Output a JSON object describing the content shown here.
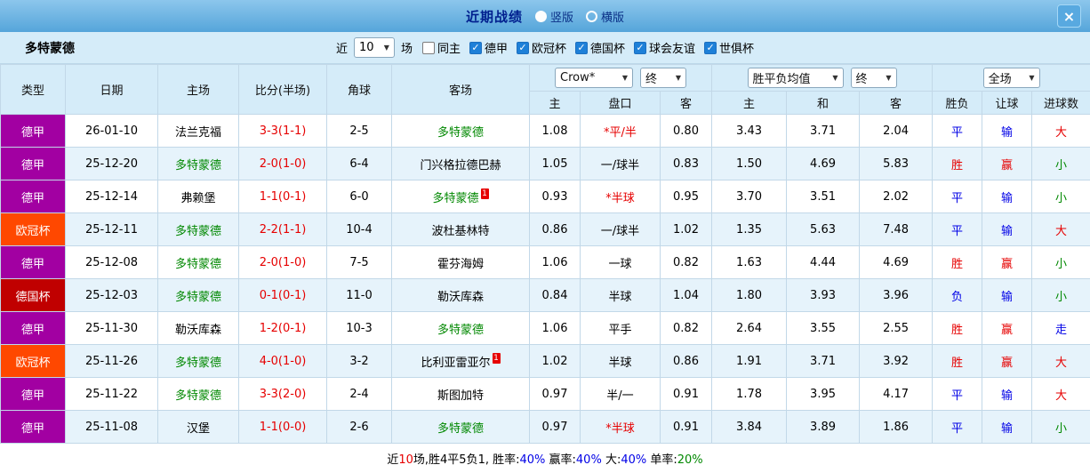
{
  "titlebar": {
    "title": "近期战绩",
    "close_glyph": "×",
    "radios": [
      {
        "label": "竖版",
        "selected": true
      },
      {
        "label": "横版",
        "selected": false
      }
    ]
  },
  "filterbar": {
    "team": "多特蒙德",
    "recent_label": "近",
    "recent_value": "10",
    "games_label": "场",
    "checkboxes": [
      {
        "label": "同主",
        "checked": false
      },
      {
        "label": "德甲",
        "checked": true
      },
      {
        "label": "欧冠杯",
        "checked": true
      },
      {
        "label": "德国杯",
        "checked": true
      },
      {
        "label": "球会友谊",
        "checked": true
      },
      {
        "label": "世俱杯",
        "checked": true
      }
    ]
  },
  "colors": {
    "league": {
      "德甲": "#a200a2",
      "欧冠杯": "#ff4800",
      "德国杯": "#c00000"
    },
    "text": {
      "red": "#e60000",
      "blue": "#0000e6",
      "green": "#008800",
      "black": "#000000"
    }
  },
  "table": {
    "badge_text": "1",
    "header": {
      "type": "类型",
      "date": "日期",
      "home": "主场",
      "score": "比分(半场)",
      "corners": "角球",
      "away": "客场",
      "asian_select": "Crow*",
      "asian_final_select": "终",
      "asian_cols": {
        "home": "主",
        "handicap": "盘口",
        "away": "客"
      },
      "euro_select": "胜平负均值",
      "euro_final_select": "终",
      "euro_cols": {
        "home": "主",
        "draw": "和",
        "away": "客"
      },
      "scope_select": "全场",
      "result_cols": {
        "result": "胜负",
        "handicap": "让球",
        "goals": "进球数"
      }
    },
    "rows": [
      {
        "league": "德甲",
        "date": "26-01-10",
        "home": "法兰克福",
        "home_color": "black",
        "home_badge": false,
        "score": "3-3(1-1)",
        "corners": "2-5",
        "away": "多特蒙德",
        "away_color": "green",
        "away_badge": false,
        "asian_home": "1.08",
        "handicap": "*平/半",
        "handicap_color": "red",
        "asian_away": "0.80",
        "euro_home": "3.43",
        "euro_draw": "3.71",
        "euro_away": "2.04",
        "result": "平",
        "result_color": "blue",
        "handicap_result": "输",
        "handicap_result_color": "blue",
        "goals": "大",
        "goals_color": "red"
      },
      {
        "league": "德甲",
        "date": "25-12-20",
        "home": "多特蒙德",
        "home_color": "green",
        "home_badge": false,
        "score": "2-0(1-0)",
        "corners": "6-4",
        "away": "门兴格拉德巴赫",
        "away_color": "black",
        "away_badge": false,
        "asian_home": "1.05",
        "handicap": "一/球半",
        "handicap_color": "black",
        "asian_away": "0.83",
        "euro_home": "1.50",
        "euro_draw": "4.69",
        "euro_away": "5.83",
        "result": "胜",
        "result_color": "red",
        "handicap_result": "赢",
        "handicap_result_color": "red",
        "goals": "小",
        "goals_color": "green"
      },
      {
        "league": "德甲",
        "date": "25-12-14",
        "home": "弗赖堡",
        "home_color": "black",
        "home_badge": false,
        "score": "1-1(0-1)",
        "corners": "6-0",
        "away": "多特蒙德",
        "away_color": "green",
        "away_badge": true,
        "asian_home": "0.93",
        "handicap": "*半球",
        "handicap_color": "red",
        "asian_away": "0.95",
        "euro_home": "3.70",
        "euro_draw": "3.51",
        "euro_away": "2.02",
        "result": "平",
        "result_color": "blue",
        "handicap_result": "输",
        "handicap_result_color": "blue",
        "goals": "小",
        "goals_color": "green"
      },
      {
        "league": "欧冠杯",
        "date": "25-12-11",
        "home": "多特蒙德",
        "home_color": "green",
        "home_badge": false,
        "score": "2-2(1-1)",
        "corners": "10-4",
        "away": "波杜基林特",
        "away_color": "black",
        "away_badge": false,
        "asian_home": "0.86",
        "handicap": "一/球半",
        "handicap_color": "black",
        "asian_away": "1.02",
        "euro_home": "1.35",
        "euro_draw": "5.63",
        "euro_away": "7.48",
        "result": "平",
        "result_color": "blue",
        "handicap_result": "输",
        "handicap_result_color": "blue",
        "goals": "大",
        "goals_color": "red"
      },
      {
        "league": "德甲",
        "date": "25-12-08",
        "home": "多特蒙德",
        "home_color": "green",
        "home_badge": false,
        "score": "2-0(1-0)",
        "corners": "7-5",
        "away": "霍芬海姆",
        "away_color": "black",
        "away_badge": false,
        "asian_home": "1.06",
        "handicap": "一球",
        "handicap_color": "black",
        "asian_away": "0.82",
        "euro_home": "1.63",
        "euro_draw": "4.44",
        "euro_away": "4.69",
        "result": "胜",
        "result_color": "red",
        "handicap_result": "赢",
        "handicap_result_color": "red",
        "goals": "小",
        "goals_color": "green"
      },
      {
        "league": "德国杯",
        "date": "25-12-03",
        "home": "多特蒙德",
        "home_color": "green",
        "home_badge": false,
        "score": "0-1(0-1)",
        "corners": "11-0",
        "away": "勒沃库森",
        "away_color": "black",
        "away_badge": false,
        "asian_home": "0.84",
        "handicap": "半球",
        "handicap_color": "black",
        "asian_away": "1.04",
        "euro_home": "1.80",
        "euro_draw": "3.93",
        "euro_away": "3.96",
        "result": "负",
        "result_color": "blue",
        "handicap_result": "输",
        "handicap_result_color": "blue",
        "goals": "小",
        "goals_color": "green"
      },
      {
        "league": "德甲",
        "date": "25-11-30",
        "home": "勒沃库森",
        "home_color": "black",
        "home_badge": false,
        "score": "1-2(0-1)",
        "corners": "10-3",
        "away": "多特蒙德",
        "away_color": "green",
        "away_badge": false,
        "asian_home": "1.06",
        "handicap": "平手",
        "handicap_color": "black",
        "asian_away": "0.82",
        "euro_home": "2.64",
        "euro_draw": "3.55",
        "euro_away": "2.55",
        "result": "胜",
        "result_color": "red",
        "handicap_result": "赢",
        "handicap_result_color": "red",
        "goals": "走",
        "goals_color": "blue"
      },
      {
        "league": "欧冠杯",
        "date": "25-11-26",
        "home": "多特蒙德",
        "home_color": "green",
        "home_badge": false,
        "score": "4-0(1-0)",
        "corners": "3-2",
        "away": "比利亚雷亚尔",
        "away_color": "black",
        "away_badge": true,
        "asian_home": "1.02",
        "handicap": "半球",
        "handicap_color": "black",
        "asian_away": "0.86",
        "euro_home": "1.91",
        "euro_draw": "3.71",
        "euro_away": "3.92",
        "result": "胜",
        "result_color": "red",
        "handicap_result": "赢",
        "handicap_result_color": "red",
        "goals": "大",
        "goals_color": "red"
      },
      {
        "league": "德甲",
        "date": "25-11-22",
        "home": "多特蒙德",
        "home_color": "green",
        "home_badge": false,
        "score": "3-3(2-0)",
        "corners": "2-4",
        "away": "斯图加特",
        "away_color": "black",
        "away_badge": false,
        "asian_home": "0.97",
        "handicap": "半/一",
        "handicap_color": "black",
        "asian_away": "0.91",
        "euro_home": "1.78",
        "euro_draw": "3.95",
        "euro_away": "4.17",
        "result": "平",
        "result_color": "blue",
        "handicap_result": "输",
        "handicap_result_color": "blue",
        "goals": "大",
        "goals_color": "red"
      },
      {
        "league": "德甲",
        "date": "25-11-08",
        "home": "汉堡",
        "home_color": "black",
        "home_badge": false,
        "score": "1-1(0-0)",
        "corners": "2-6",
        "away": "多特蒙德",
        "away_color": "green",
        "away_badge": false,
        "asian_home": "0.97",
        "handicap": "*半球",
        "handicap_color": "red",
        "asian_away": "0.91",
        "euro_home": "3.84",
        "euro_draw": "3.89",
        "euro_away": "1.86",
        "result": "平",
        "result_color": "blue",
        "handicap_result": "输",
        "handicap_result_color": "blue",
        "goals": "小",
        "goals_color": "green"
      }
    ]
  },
  "footer": {
    "segments": [
      {
        "text": "近",
        "color": "black"
      },
      {
        "text": "10",
        "color": "red"
      },
      {
        "text": "场,胜4平5负1, 胜率:",
        "color": "black"
      },
      {
        "text": "40%",
        "color": "blue"
      },
      {
        "text": " 赢率:",
        "color": "black"
      },
      {
        "text": "40%",
        "color": "blue"
      },
      {
        "text": " 大:",
        "color": "black"
      },
      {
        "text": "40%",
        "color": "blue"
      },
      {
        "text": " 单率:",
        "color": "black"
      },
      {
        "text": "20%",
        "color": "green"
      }
    ]
  }
}
